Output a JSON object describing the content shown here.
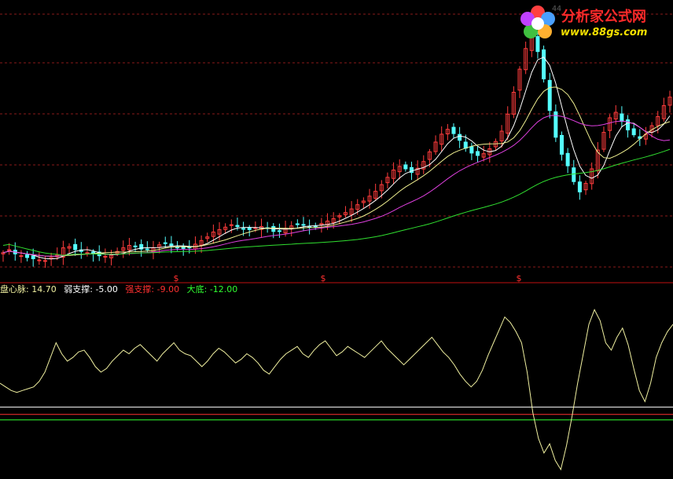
{
  "watermark": {
    "site_name": "分析家公式网",
    "url": "www.88gs.com",
    "price_label": "44"
  },
  "indicator": {
    "items": [
      {
        "label": "盘心脉:",
        "value": "14.70",
        "color": "#f0f0a0"
      },
      {
        "label": "弱支撑:",
        "value": "-5.00",
        "color": "#ffffff"
      },
      {
        "label": "强支撑:",
        "value": "-9.00",
        "color": "#ff3030"
      },
      {
        "label": "大底:",
        "value": "-12.00",
        "color": "#30ff30"
      }
    ]
  },
  "markers": {
    "symbol": "$",
    "color": "#ff3030"
  },
  "colors": {
    "background": "#000000",
    "grid": "#8a1a1a",
    "up_candle": "#ff3c3c",
    "down_candle": "#54ffff",
    "ma_short": "#ffffff",
    "ma_mid": "#f0f090",
    "ma_long": "#e040e0",
    "ma_longest": "#30e030",
    "oscillator": "#f0f0a0",
    "weak_support": "#ffffff",
    "strong_support": "#ff3030",
    "bottom": "#30ff30"
  },
  "chart_data": [
    {
      "type": "candlestick",
      "name": "price",
      "gridlines": true,
      "close": [
        27,
        27.5,
        26.8,
        26.5,
        26.2,
        26.0,
        25.8,
        25.7,
        26.2,
        26.6,
        27.8,
        28.0,
        27.5,
        27.2,
        27.0,
        26.8,
        26.5,
        26.4,
        26.6,
        27.2,
        27.8,
        28.2,
        28.0,
        27.6,
        27.5,
        27.8,
        28.3,
        28.6,
        28.2,
        27.8,
        27.7,
        27.9,
        28.4,
        29.0,
        29.6,
        30.4,
        30.8,
        31.2,
        31.6,
        31.3,
        30.9,
        30.8,
        31.1,
        31.3,
        31.0,
        30.5,
        30.6,
        31.0,
        31.4,
        31.7,
        31.6,
        31.2,
        31.3,
        31.8,
        32.2,
        32.6,
        33.1,
        33.6,
        34.2,
        34.9,
        35.5,
        36.3,
        37.1,
        38.2,
        39.4,
        40.6,
        41.2,
        40.8,
        40.2,
        40.9,
        42.0,
        43.6,
        45.2,
        46.5,
        47.3,
        46.6,
        45.5,
        44.2,
        43.4,
        43.0,
        43.3,
        44.1,
        45.3,
        47.0,
        49.8,
        53.4,
        57.2,
        60.6,
        62.4,
        60.1,
        55.6,
        50.4,
        46.0,
        43.2,
        41.3,
        38.7,
        37.0,
        38.4,
        40.8,
        43.9,
        46.8,
        49.2,
        50.1,
        48.6,
        47.2,
        46.4,
        45.8,
        46.5,
        47.9,
        49.4,
        51.2,
        52.6
      ],
      "yrange": [
        24,
        66
      ]
    },
    {
      "type": "line",
      "name": "oscillator",
      "values": [
        8,
        6,
        4,
        3,
        4,
        5,
        6,
        9,
        14,
        22,
        30,
        24,
        20,
        22,
        25,
        26,
        22,
        17,
        14,
        16,
        20,
        23,
        26,
        24,
        27,
        29,
        26,
        23,
        20,
        24,
        27,
        30,
        26,
        24,
        23,
        20,
        17,
        20,
        24,
        27,
        25,
        22,
        19,
        21,
        24,
        22,
        19,
        15,
        13,
        17,
        21,
        24,
        26,
        28,
        24,
        22,
        26,
        29,
        31,
        27,
        23,
        25,
        28,
        26,
        24,
        22,
        25,
        28,
        31,
        27,
        24,
        21,
        18,
        21,
        24,
        27,
        30,
        33,
        29,
        25,
        22,
        18,
        13,
        9,
        6,
        9,
        15,
        23,
        30,
        37,
        44,
        41,
        36,
        30,
        14,
        -8,
        -22,
        -30,
        -25,
        -34,
        -39,
        -26,
        -10,
        8,
        24,
        40,
        48,
        42,
        30,
        26,
        33,
        38,
        29,
        16,
        4,
        -2,
        8,
        22,
        30,
        36,
        40
      ],
      "levels": {
        "weak_support": -5.0,
        "strong_support": -9.0,
        "bottom": -12.0
      },
      "yrange": [
        -42,
        52
      ]
    }
  ]
}
